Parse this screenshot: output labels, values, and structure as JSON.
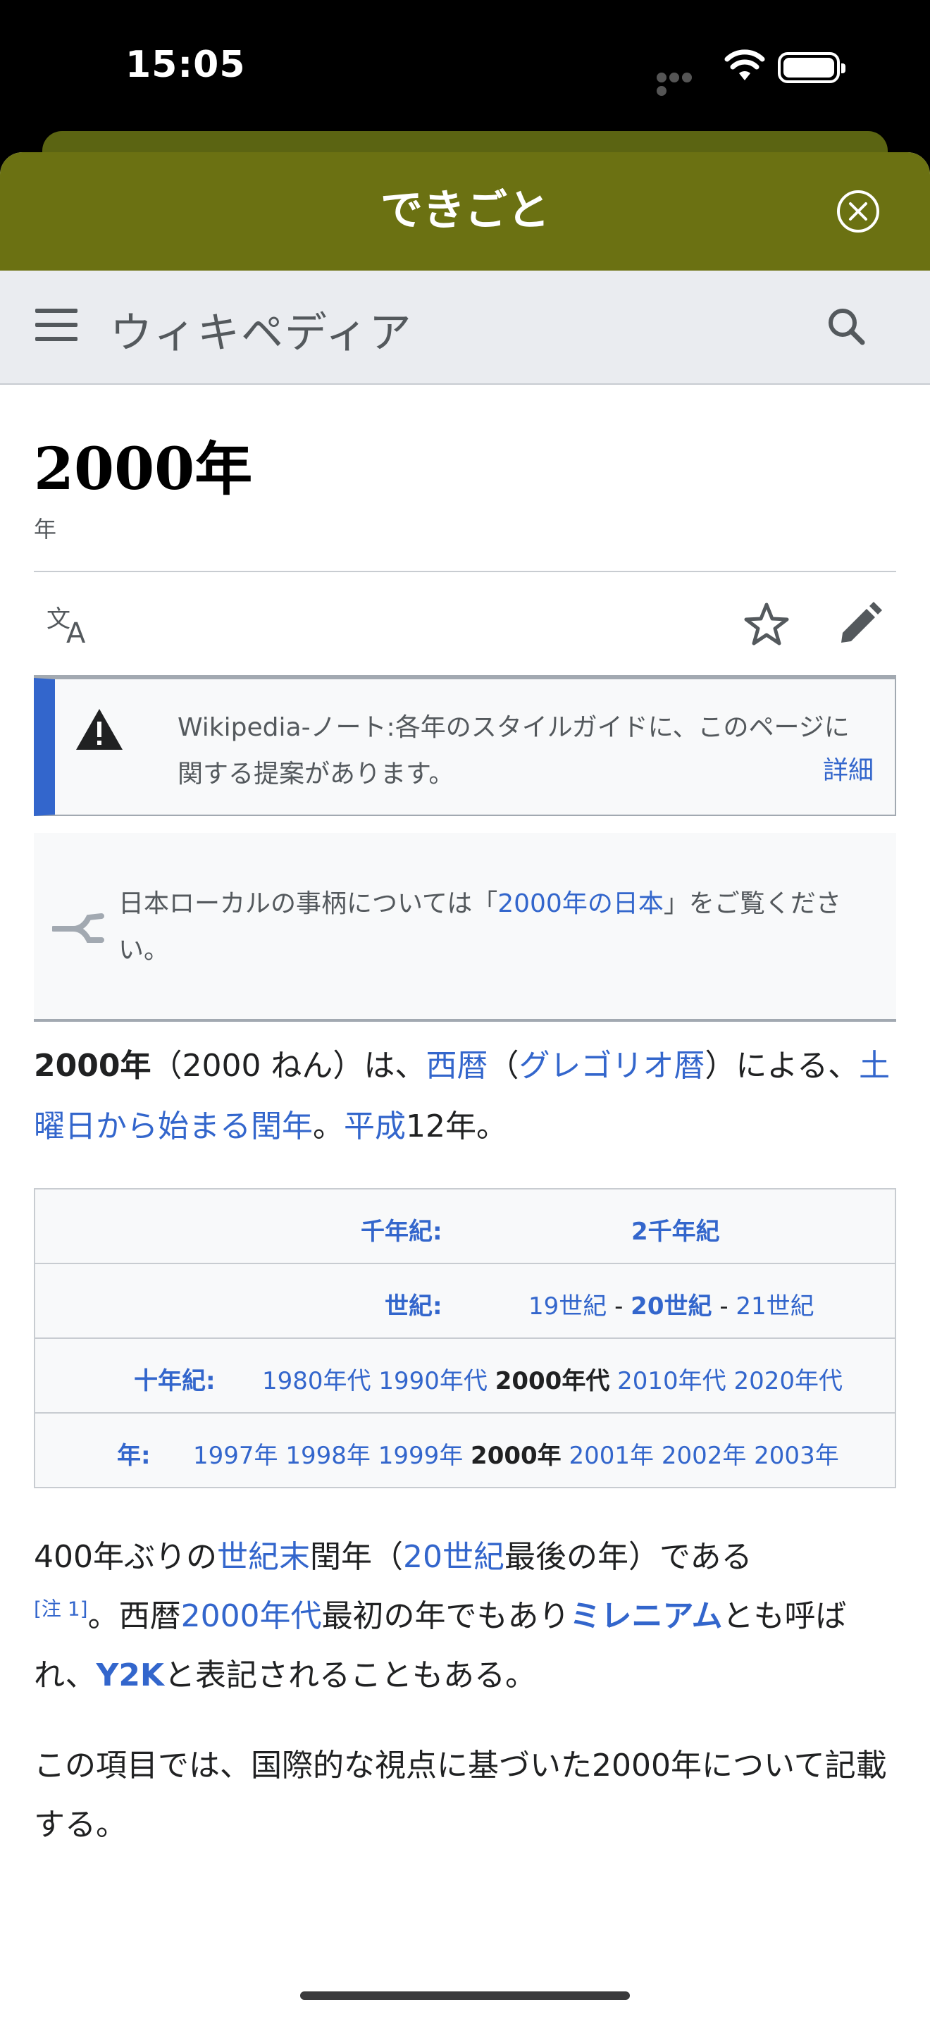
{
  "status": {
    "time": "15:05"
  },
  "sheet": {
    "title": "できごと"
  },
  "wiki": {
    "logo": "ウィキペディア"
  },
  "article": {
    "title": "2000年",
    "description": "年"
  },
  "notice": {
    "text": "Wikipedia-ノート:各年のスタイルガイドに、このページに関する提案があります。",
    "more": "詳細"
  },
  "hatnote": {
    "prefix": "日本ローカルの事柄については「",
    "link": "2000年の日本",
    "suffix": "」をご覧ください。"
  },
  "lead": {
    "bold": "2000年",
    "t1": "（2000 ねん）は、",
    "l1": "西暦",
    "t2": "（",
    "l2": "グレゴリオ暦",
    "t3": "）による、",
    "l3": "土曜日から始まる閏年",
    "t4": "。",
    "l4": "平成",
    "t5": "12年。"
  },
  "navbox": {
    "millennium_label": "千年紀",
    "millennium_value": "2千年紀",
    "century_label": "世紀",
    "centuries": [
      "19世紀",
      "20世紀",
      "21世紀"
    ],
    "decade_label": "十年紀",
    "decades": [
      "1980年代",
      "1990年代",
      "2000年代",
      "2010年代",
      "2020年代"
    ],
    "year_label": "年",
    "years": [
      "1997年",
      "1998年",
      "1999年",
      "2000年",
      "2001年",
      "2002年",
      "2003年"
    ],
    "colon": ":",
    "dash": "-"
  },
  "para1": {
    "t1": "400年ぶりの",
    "l1": "世紀末",
    "t2": "閏年（",
    "l2": "20世紀",
    "t3": "最後の年）である",
    "note": "[注 1]",
    "t4": "。西暦",
    "l3": "2000年代",
    "t5": "最初の年でもあり",
    "l4": "ミレニアム",
    "t6": "とも呼ばれ、",
    "l5": "Y2K",
    "t7": "と表記されることもある。"
  },
  "para2": {
    "text": "この項目では、国際的な視点に基づいた2000年について記載する。"
  },
  "icons": {
    "close": "close-circle-icon",
    "menu": "hamburger-menu-icon",
    "search": "search-icon",
    "language": "translate-icon",
    "watch": "star-icon",
    "edit": "pencil-icon",
    "warning": "warning-icon",
    "hatnote": "split-arrow-icon"
  },
  "colors": {
    "header": "#6b7112",
    "link": "#3366cc",
    "notice_bar": "#3366cc"
  }
}
